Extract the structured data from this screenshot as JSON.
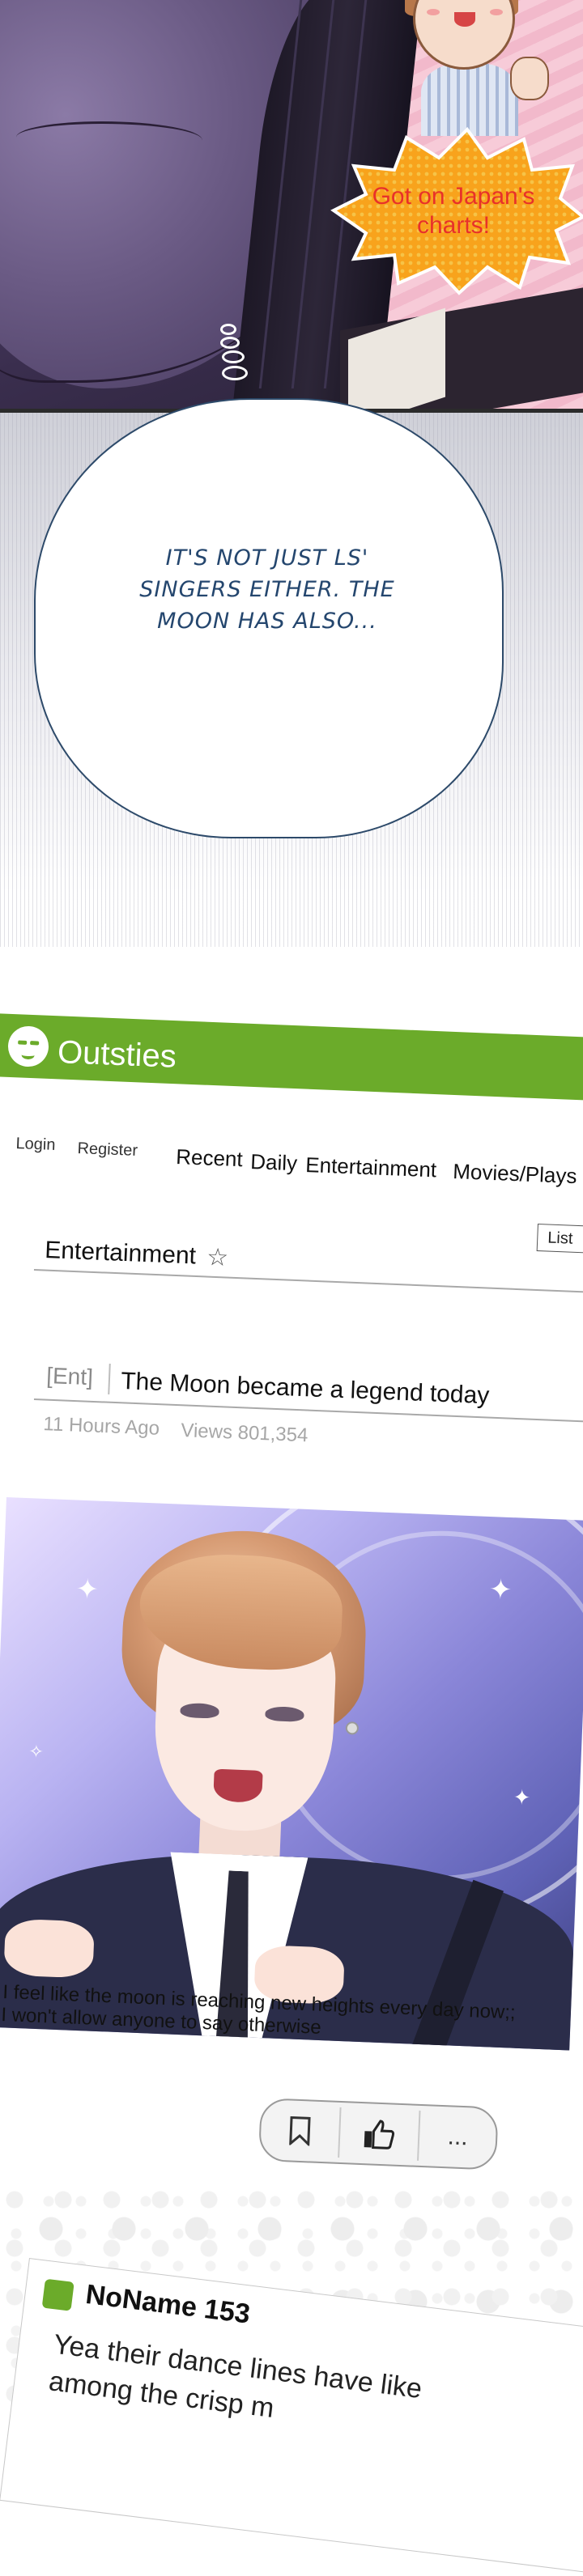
{
  "manga": {
    "burst_text": "Got on Japan's charts!",
    "thought_text": "It's not just LS' singers either. The moon has also..."
  },
  "site": {
    "name": "Outsties",
    "brand_color": "#6bab2a",
    "nav": {
      "login": "Login",
      "register": "Register",
      "categories": [
        "Recent",
        "Daily",
        "Entertainment",
        "Movies/Plays"
      ]
    },
    "board": {
      "title": "Entertainment",
      "star_icon": "star-outline-icon",
      "list_button": "List"
    },
    "post": {
      "tag": "[Ent]",
      "title": "The Moon became a legend today",
      "time": "11 Hours Ago",
      "views": "Views 801,354",
      "caption_line1": "I feel like the moon is reaching new heights every day now;;",
      "caption_line2": "I won't allow anyone to say otherwise",
      "actions": [
        "bookmark-icon",
        "thumbs-up-icon",
        "more-icon"
      ],
      "more_label": "..."
    },
    "comment": {
      "user": "NoName 153",
      "text": "Yea their dance lines have like among the crisp m"
    }
  }
}
